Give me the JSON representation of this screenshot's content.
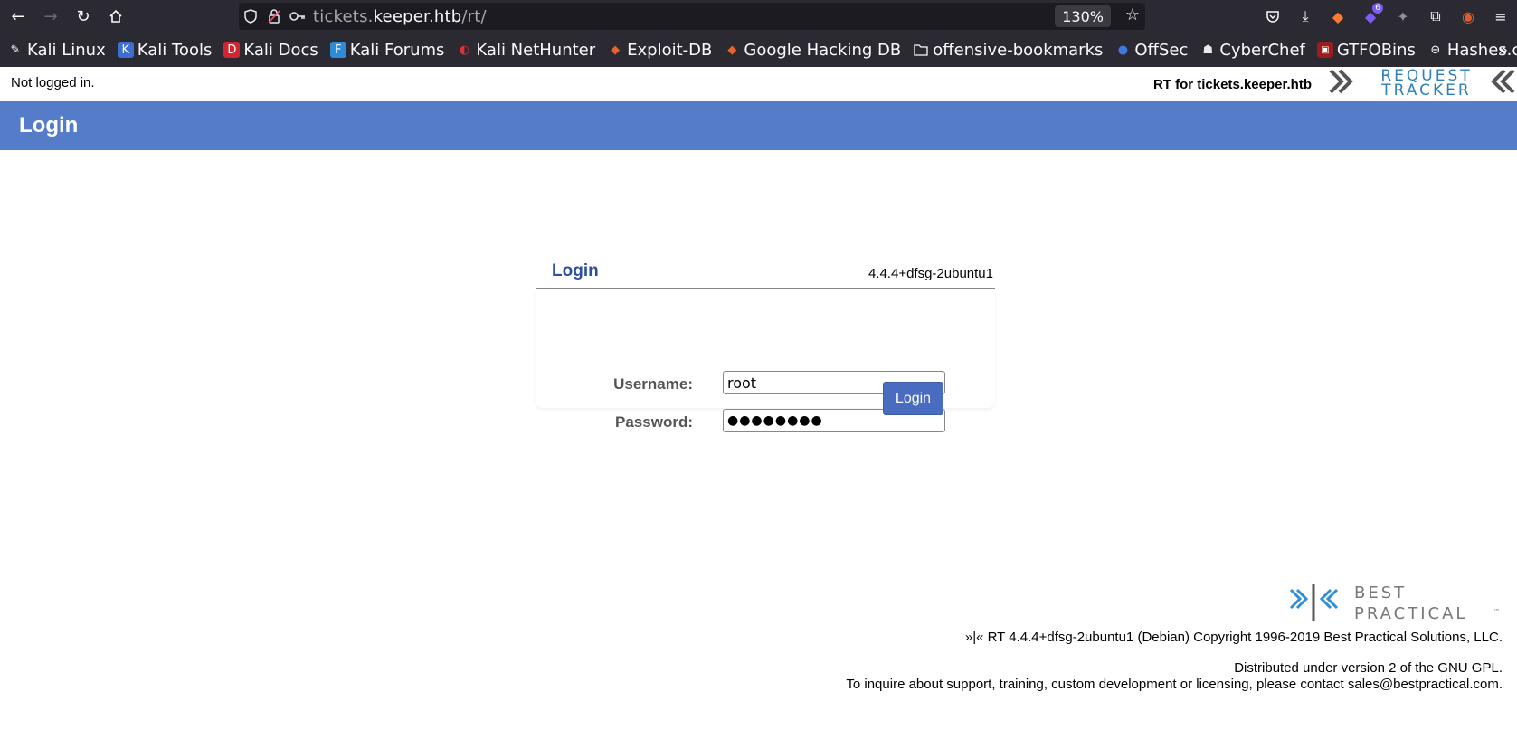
{
  "browser": {
    "url_prefix": "tickets.",
    "url_domain": "keeper.htb",
    "url_path": "/rt/",
    "zoom": "130%",
    "extension_badge": "6",
    "bookmarks": [
      {
        "label": "Kali Linux",
        "icon": "kali-icon"
      },
      {
        "label": "Kali Tools",
        "icon": "kali-tools-icon"
      },
      {
        "label": "Kali Docs",
        "icon": "kali-docs-icon"
      },
      {
        "label": "Kali Forums",
        "icon": "kali-forums-icon"
      },
      {
        "label": "Kali NetHunter",
        "icon": "nethunter-icon"
      },
      {
        "label": "Exploit-DB",
        "icon": "exploitdb-icon"
      },
      {
        "label": "Google Hacking DB",
        "icon": "ghdb-icon"
      },
      {
        "label": "offensive-bookmarks",
        "icon": "folder-icon"
      },
      {
        "label": "OffSec",
        "icon": "offsec-icon"
      },
      {
        "label": "CyberChef",
        "icon": "cyberchef-icon"
      },
      {
        "label": "GTFOBins",
        "icon": "gtfobins-icon"
      },
      {
        "label": "Hashes.com",
        "icon": "hashes-icon"
      }
    ]
  },
  "page": {
    "status": "Not logged in.",
    "rt_for": "RT for tickets.keeper.htb",
    "logo_line1": "REQUEST",
    "logo_line2": "TRACKER",
    "title": "Login"
  },
  "login": {
    "box_title": "Login",
    "version": "4.4.4+dfsg-2ubuntu1",
    "username_label": "Username:",
    "username_value": "root",
    "password_label": "Password:",
    "password_mask": "●●●●●●●●",
    "submit_label": "Login"
  },
  "footer": {
    "logo_line1": "BEST",
    "logo_line2": "PRACTICAL",
    "tm": "™",
    "copyright": "»|« RT 4.4.4+dfsg-2ubuntu1 (Debian) Copyright 1996-2019 Best Practical Solutions, LLC.",
    "license": "Distributed under version 2 of the GNU GPL.",
    "contact": "To inquire about support, training, custom development or licensing, please contact sales@bestpractical.com."
  }
}
